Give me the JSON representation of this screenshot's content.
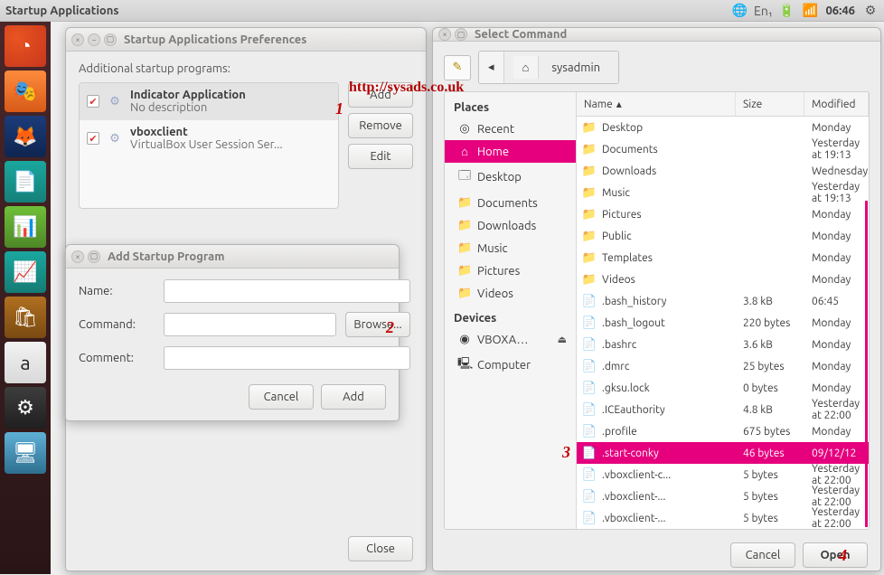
{
  "top_panel": {
    "title": "Startup Applications",
    "clock": "06:46",
    "lang": "En₁"
  },
  "launcher_items": [
    "ubuntu",
    "mask",
    "firefox",
    "libre1",
    "libre2",
    "libre3",
    "software",
    "amazon",
    "settings",
    "workspace"
  ],
  "prefs": {
    "title": "Startup Applications Preferences",
    "heading": "Additional startup programs:",
    "items": [
      {
        "name": "Indicator Application",
        "desc": "No description",
        "checked": true,
        "selected": true
      },
      {
        "name": "vboxclient",
        "desc": "VirtualBox User Session Ser...",
        "checked": true,
        "selected": false
      }
    ],
    "buttons": {
      "add": "Add",
      "remove": "Remove",
      "edit": "Edit",
      "close": "Close"
    }
  },
  "add_dialog": {
    "title": "Add Startup Program",
    "labels": {
      "name": "Name:",
      "command": "Command:",
      "comment": "Comment:"
    },
    "values": {
      "name": "",
      "command": "",
      "comment": ""
    },
    "buttons": {
      "browse": "Browse...",
      "cancel": "Cancel",
      "add": "Add"
    }
  },
  "file_chooser": {
    "title": "Select Command",
    "path": {
      "seg1": "◂",
      "seg2": "sysadmin"
    },
    "places_header": "Places",
    "devices_header": "Devices",
    "places": [
      {
        "label": "Recent",
        "icon": "◎"
      },
      {
        "label": "Home",
        "icon": "⌂",
        "selected": true
      },
      {
        "label": "Desktop",
        "icon": "🗔"
      },
      {
        "label": "Documents",
        "icon": "📁"
      },
      {
        "label": "Downloads",
        "icon": "📁"
      },
      {
        "label": "Music",
        "icon": "📁"
      },
      {
        "label": "Pictures",
        "icon": "📁"
      },
      {
        "label": "Videos",
        "icon": "📁"
      }
    ],
    "devices": [
      {
        "label": "VBOXA…",
        "icon": "◉",
        "eject": true
      },
      {
        "label": "Computer",
        "icon": "🖳"
      }
    ],
    "columns": {
      "name": "Name",
      "size": "Size",
      "modified": "Modified"
    },
    "rows": [
      {
        "name": "Desktop",
        "size": "",
        "modified": "Monday",
        "type": "folder"
      },
      {
        "name": "Documents",
        "size": "",
        "modified": "Yesterday at 19:13",
        "type": "folder"
      },
      {
        "name": "Downloads",
        "size": "",
        "modified": "Wednesday",
        "type": "folder"
      },
      {
        "name": "Music",
        "size": "",
        "modified": "Yesterday at 19:13",
        "type": "folder"
      },
      {
        "name": "Pictures",
        "size": "",
        "modified": "Monday",
        "type": "folder"
      },
      {
        "name": "Public",
        "size": "",
        "modified": "Monday",
        "type": "folder"
      },
      {
        "name": "Templates",
        "size": "",
        "modified": "Monday",
        "type": "folder"
      },
      {
        "name": "Videos",
        "size": "",
        "modified": "Monday",
        "type": "folder"
      },
      {
        "name": ".bash_history",
        "size": "3.8 kB",
        "modified": "06:45",
        "type": "file"
      },
      {
        "name": ".bash_logout",
        "size": "220 bytes",
        "modified": "Monday",
        "type": "file"
      },
      {
        "name": ".bashrc",
        "size": "3.6 kB",
        "modified": "Monday",
        "type": "file"
      },
      {
        "name": ".dmrc",
        "size": "25 bytes",
        "modified": "Monday",
        "type": "file"
      },
      {
        "name": ".gksu.lock",
        "size": "0 bytes",
        "modified": "Monday",
        "type": "file"
      },
      {
        "name": ".ICEauthority",
        "size": "4.8 kB",
        "modified": "Yesterday at 22:00",
        "type": "file"
      },
      {
        "name": ".profile",
        "size": "675 bytes",
        "modified": "Monday",
        "type": "file"
      },
      {
        "name": ".start-conky",
        "size": "46 bytes",
        "modified": "09/12/12",
        "type": "file",
        "selected": true
      },
      {
        "name": ".vboxclient-c...",
        "size": "5 bytes",
        "modified": "Yesterday at 22:00",
        "type": "file"
      },
      {
        "name": ".vboxclient-...",
        "size": "5 bytes",
        "modified": "Yesterday at 22:00",
        "type": "file"
      },
      {
        "name": ".vboxclient-...",
        "size": "5 bytes",
        "modified": "Yesterday at 22:00",
        "type": "file"
      }
    ],
    "buttons": {
      "cancel": "Cancel",
      "open": "Open"
    }
  },
  "annotations": {
    "url": "http://sysads.co.uk",
    "n1": "1",
    "n2": "2",
    "n3": "3",
    "n4": "4"
  }
}
